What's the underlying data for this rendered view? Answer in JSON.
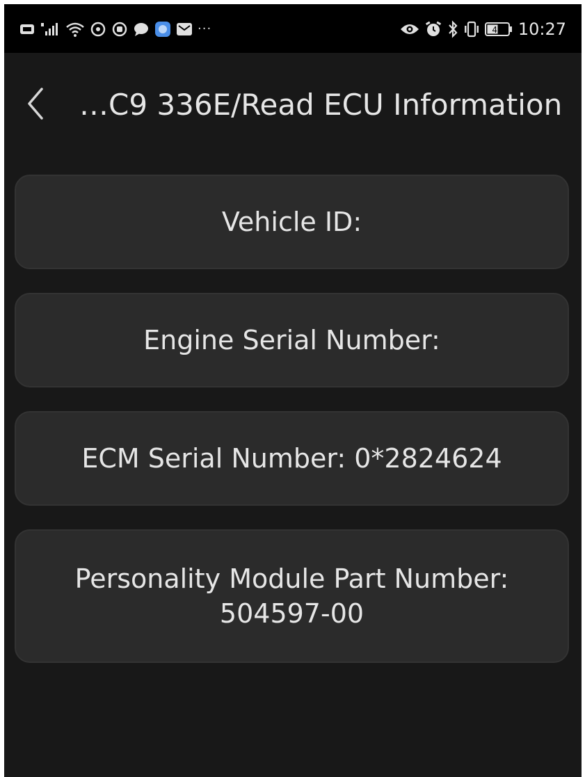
{
  "status_bar": {
    "left_icons": [
      "hd-icon",
      "signal-4g-icon",
      "wifi-icon",
      "app-notification-icon",
      "app-notification-icon-2",
      "chat-icon",
      "blue-app-icon",
      "mail-icon"
    ],
    "overflow": "···",
    "right_icons": [
      "eye-icon",
      "alarm-icon",
      "bluetooth-icon",
      "vibrate-icon"
    ],
    "battery_level": "47",
    "time": "10:27"
  },
  "header": {
    "back_icon": "chevron-left-icon",
    "title": "…C9 336E/Read ECU Information"
  },
  "info_items": [
    {
      "label": "Vehicle ID:"
    },
    {
      "label": "Engine Serial Number:"
    },
    {
      "label": "ECM Serial Number: 0*2824624"
    },
    {
      "line1": "Personality Module Part Number:",
      "line2": "504597-00"
    }
  ],
  "colors": {
    "status_bar_bg": "#000000",
    "screen_bg": "#181818",
    "card_bg": "#2b2b2b",
    "text": "#e6e6e6"
  }
}
